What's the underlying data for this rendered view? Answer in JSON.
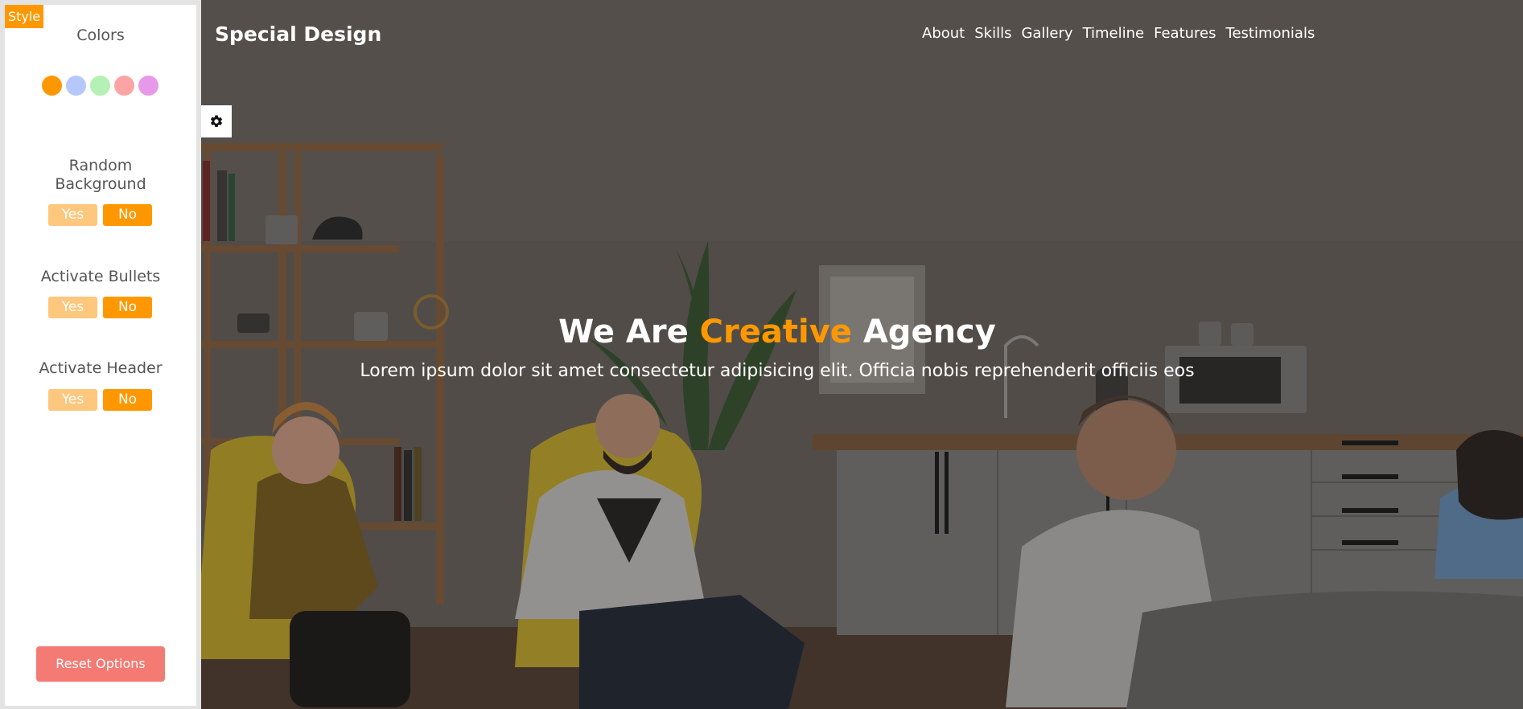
{
  "settings": {
    "tag": "Style",
    "colors_title": "Colors",
    "colors": [
      "#ff9800",
      "#b6c8fa",
      "#b4f1b4",
      "#fca4a4",
      "#e798e9"
    ],
    "random_background": {
      "title": "Random Background",
      "yes": "Yes",
      "no": "No"
    },
    "bullets": {
      "title": "Activate Bullets",
      "yes": "Yes",
      "no": "No"
    },
    "header": {
      "title": "Activate Header",
      "yes": "Yes",
      "no": "No"
    },
    "reset_label": "Reset Options"
  },
  "site": {
    "logo": "Special Design",
    "nav": [
      "About",
      "Skills",
      "Gallery",
      "Timeline",
      "Features",
      "Testimonials"
    ],
    "intro": {
      "heading_before": "We Are ",
      "heading_accent": "Creative",
      "heading_after": " Agency",
      "text": "Lorem ipsum dolor sit amet consectetur adipisicing elit. Officia nobis reprehenderit officiis eos"
    }
  },
  "theme": {
    "main_color": "#ff9800",
    "reset_color": "#f47a74"
  },
  "icons": {
    "settings_toggle": "gear-icon"
  }
}
